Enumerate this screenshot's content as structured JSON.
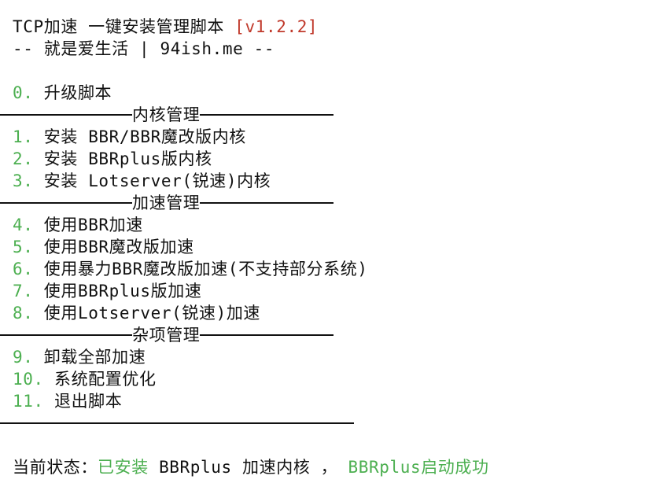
{
  "header": {
    "title": "TCP加速 一键安装管理脚本",
    "version": "[v1.2.2]",
    "subtitle": "-- 就是爱生活 | 94ish.me --"
  },
  "menu": {
    "upgrade": {
      "num": "0.",
      "label": "升级脚本"
    },
    "section_kernel": "内核管理",
    "kernel_items": [
      {
        "num": "1.",
        "label": "安装 BBR/BBR魔改版内核"
      },
      {
        "num": "2.",
        "label": "安装 BBRplus版内核"
      },
      {
        "num": "3.",
        "label": "安装 Lotserver(锐速)内核"
      }
    ],
    "section_accel": "加速管理",
    "accel_items": [
      {
        "num": "4.",
        "label": "使用BBR加速"
      },
      {
        "num": "5.",
        "label": "使用BBR魔改版加速"
      },
      {
        "num": "6.",
        "label": "使用暴力BBR魔改版加速(不支持部分系统)"
      },
      {
        "num": "7.",
        "label": "使用BBRplus版加速"
      },
      {
        "num": "8.",
        "label": "使用Lotserver(锐速)加速"
      }
    ],
    "section_misc": "杂项管理",
    "misc_items": [
      {
        "num": "9.",
        "label": "卸载全部加速"
      },
      {
        "num": "10.",
        "label": "系统配置优化"
      },
      {
        "num": "11.",
        "label": "退出脚本"
      }
    ]
  },
  "status": {
    "prefix": "当前状态：",
    "installed": "已安装",
    "kernel": "BBRplus 加速内核 ，",
    "started": "BBRplus启动成功"
  },
  "colors": {
    "accent_green": "#4caf50",
    "version_red": "#c0392b",
    "text": "#111111",
    "background": "#ffffff"
  }
}
